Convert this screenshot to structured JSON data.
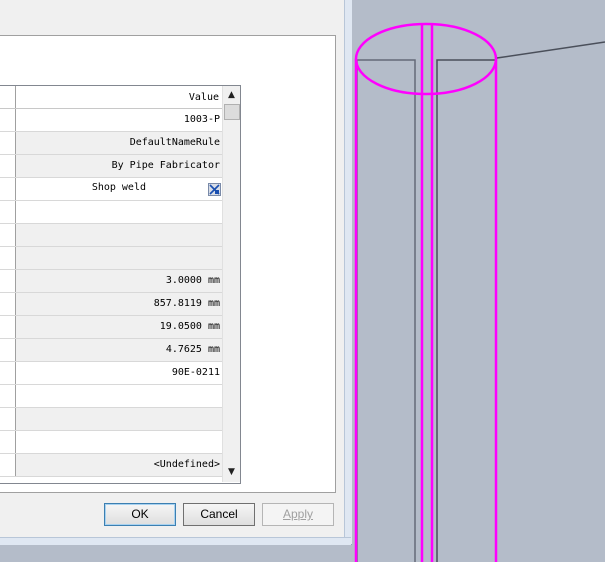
{
  "grid": {
    "header_value": "Value",
    "rows": [
      {
        "value": "1003-P"
      },
      {
        "value": "DefaultNameRule"
      },
      {
        "value": "By Pipe Fabricator"
      },
      {
        "value": "Shop weld"
      },
      {
        "value": ""
      },
      {
        "value": ""
      },
      {
        "value": ""
      },
      {
        "value": "3.0000 mm"
      },
      {
        "value": "857.8119 mm"
      },
      {
        "value": "19.0500 mm"
      },
      {
        "value": "4.7625 mm"
      },
      {
        "value": "90E-0211"
      },
      {
        "value": ""
      },
      {
        "value": ""
      },
      {
        "value": ""
      },
      {
        "value": "<Undefined>"
      }
    ]
  },
  "buttons": {
    "ok": "OK",
    "cancel": "Cancel",
    "apply": "Apply"
  },
  "colors": {
    "viewport_background": "#b4bcc9",
    "pipe_highlight": "#ff00ff",
    "pipe_edge": "#555a66"
  }
}
